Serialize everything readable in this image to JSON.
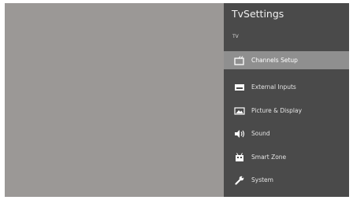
{
  "panel": {
    "title": "TvSettings",
    "section": "TV"
  },
  "menu": [
    {
      "label": "Channels Setup",
      "icon": "channels-icon",
      "selected": true
    },
    {
      "label": "External Inputs",
      "icon": "input-icon",
      "selected": false
    },
    {
      "label": "Picture & Display",
      "icon": "picture-icon",
      "selected": false
    },
    {
      "label": "Sound",
      "icon": "speaker-icon",
      "selected": false
    },
    {
      "label": "Smart Zone",
      "icon": "smart-tv-icon",
      "selected": false
    },
    {
      "label": "System",
      "icon": "wrench-icon",
      "selected": false
    }
  ],
  "colors": {
    "preview": "#9b9896",
    "panel": "#4a4a4a",
    "selected_item": "#8f8f8f"
  }
}
